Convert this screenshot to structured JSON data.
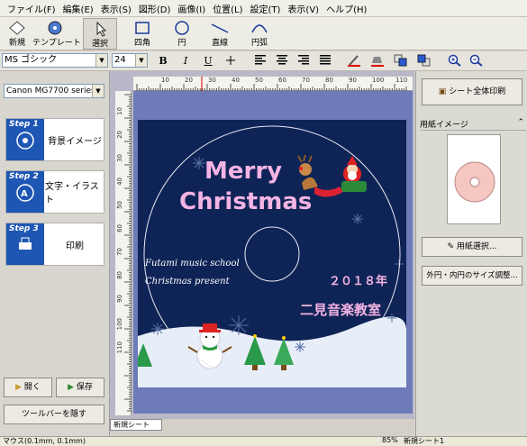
{
  "menu": [
    "ファイル(F)",
    "編集(E)",
    "表示(S)",
    "図形(D)",
    "画像(I)",
    "位置(L)",
    "設定(T)",
    "表示(V)",
    "ヘルプ(H)"
  ],
  "toolbar": {
    "new": "新規",
    "template": "テンプレート",
    "select": "選択",
    "rect": "四角",
    "circle": "円",
    "line": "直線",
    "arc": "円弧"
  },
  "format": {
    "font": "MS ゴシック",
    "size": "24",
    "bold": "B",
    "italic": "I",
    "underline": "U"
  },
  "left": {
    "printer": "Canon MG7700 series",
    "steps": [
      {
        "badge": "Step 1",
        "label": "背景イメージ"
      },
      {
        "badge": "Step 2",
        "label": "文字・イラスト"
      },
      {
        "badge": "Step 3",
        "label": "印刷"
      }
    ],
    "open": "開く",
    "save": "保存",
    "hide_toolbar": "ツールバーを隠す"
  },
  "ruler": [
    "10",
    "20",
    "30",
    "40",
    "50",
    "60",
    "70",
    "80",
    "90",
    "100",
    "110"
  ],
  "ruler_v": [
    "10",
    "20",
    "30",
    "40",
    "50",
    "60",
    "70",
    "80",
    "90",
    "100",
    "110"
  ],
  "label": {
    "title1": "Merry",
    "title2": "Christmas",
    "line1": "Futami music school",
    "line2": "Christmas  present",
    "year": "２０１８年",
    "school": "二見音楽教室"
  },
  "right": {
    "all_print": "シート全体印刷",
    "paper_image": "用紙イメージ",
    "paper_select": "用紙選択...",
    "size_adjust": "外円・内円のサイズ調整..."
  },
  "sheet_tab": "新規シート",
  "status": {
    "unit": "マウス(0.1mm, 0.1mm)",
    "zoom": "85%",
    "sheet": "新規シート1"
  },
  "colors": {
    "label_bg": "#0f2456",
    "title_pink": "#f4b4e4",
    "step_blue": "#1e56b4"
  }
}
